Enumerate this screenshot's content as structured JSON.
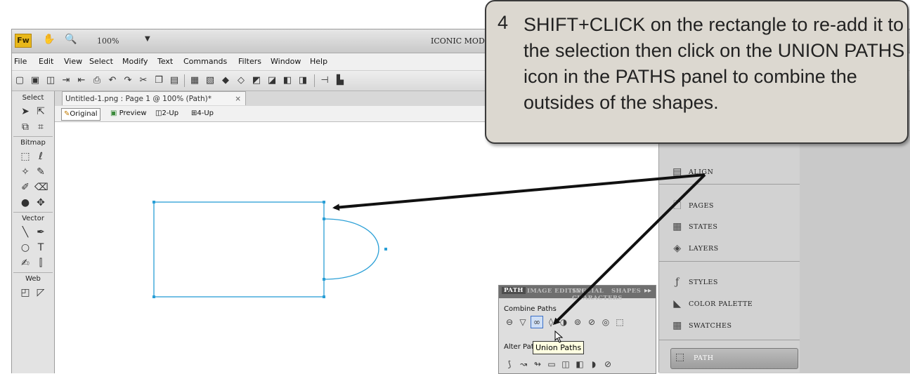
{
  "titlebar": {
    "logo": "Fw",
    "zoom": "100%",
    "workspace": "ICONIC MOD"
  },
  "menu": [
    "File",
    "Edit",
    "View",
    "Select",
    "Modify",
    "Text",
    "Commands",
    "Filters",
    "Window",
    "Help"
  ],
  "document": {
    "tab_title": "Untitled-1.png : Page 1 @ 100% (Path)*",
    "close": "×",
    "views": [
      "Original",
      "Preview",
      "2-Up",
      "4-Up"
    ]
  },
  "tools": {
    "sections": [
      "Select",
      "Bitmap",
      "Vector",
      "Web"
    ]
  },
  "panels": {
    "items": [
      "ALIGN",
      "PAGES",
      "STATES",
      "LAYERS",
      "STYLES",
      "COLOR PALETTE",
      "SWATCHES",
      "PATH"
    ]
  },
  "path_panel": {
    "tabs": [
      "PATH",
      "IMAGE EDITING",
      "SPECIAL CHARACTERS",
      "SHAPES"
    ],
    "combine_label": "Combine Paths",
    "alter_label": "Alter Paths",
    "tooltip": "Union Paths"
  },
  "callout": {
    "step": "4",
    "text": "SHIFT+CLICK on the rectangle to re-add it to the selection then click on the UNION PATHS icon in the PATHS panel to combine the outsides of the shapes."
  },
  "colors": {
    "selection": "#2a9fd6",
    "callout_bg": "#dcd8d0",
    "fw_logo": "#e8b81a"
  }
}
